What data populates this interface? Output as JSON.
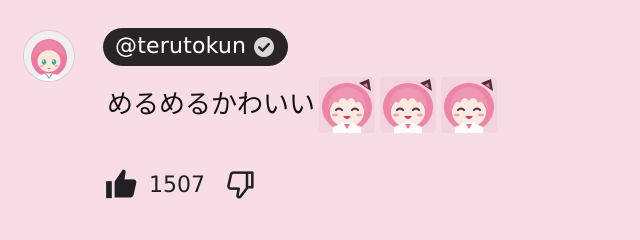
{
  "comment": {
    "author": {
      "handle": "@terutokun",
      "verified": true
    },
    "text": "めるめるかわいい",
    "emotes": [
      "anime-girl-emote",
      "anime-girl-emote",
      "anime-girl-emote"
    ],
    "likes": "1507"
  },
  "colors": {
    "background": "#f7dde6",
    "author_pill": "#2a2427",
    "text": "#141014",
    "avatar_hair": "#ee8aaa"
  },
  "icons": {
    "like": "thumbs-up-icon",
    "dislike": "thumbs-down-icon",
    "verified": "verified-check-icon"
  }
}
